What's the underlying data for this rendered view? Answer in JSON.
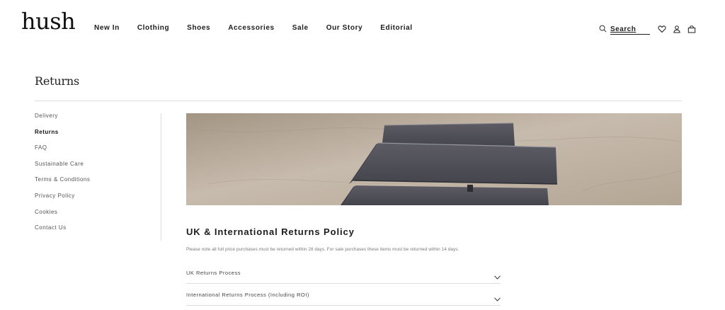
{
  "header": {
    "logo": "hush",
    "nav": [
      "New In",
      "Clothing",
      "Shoes",
      "Accessories",
      "Sale",
      "Our Story",
      "Editorial"
    ],
    "search_placeholder": "Search",
    "icons": [
      "search-icon",
      "heart-icon",
      "user-icon",
      "bag-icon"
    ]
  },
  "page": {
    "title": "Returns"
  },
  "sidebar": {
    "items": [
      {
        "label": "Delivery"
      },
      {
        "label": "Returns",
        "active": true
      },
      {
        "label": "FAQ"
      },
      {
        "label": "Sustainable Care"
      },
      {
        "label": "Terms & Conditions"
      },
      {
        "label": "Privacy Policy"
      },
      {
        "label": "Cookies"
      },
      {
        "label": "Contact Us"
      }
    ]
  },
  "main": {
    "heading": "UK & International Returns Policy",
    "note": "Please note all full price purchases must be returned within 28 days. For sale purchases these items must be returned within 14 days.",
    "accordion": [
      {
        "label": "UK Returns Process"
      },
      {
        "label": "International Returns Process (Including ROI)"
      }
    ]
  },
  "colors": {
    "text": "#1c1c1c",
    "rule": "#dcdcdc",
    "hero_bg": "#b8aa9a",
    "box": "#4a4a52"
  }
}
